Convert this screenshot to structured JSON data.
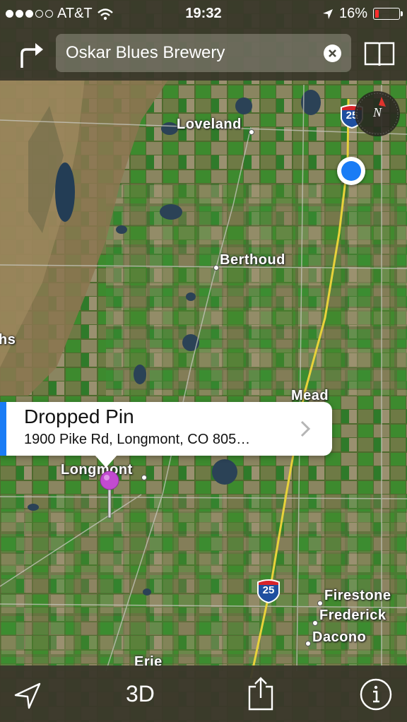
{
  "status_bar": {
    "carrier": "AT&T",
    "signal_bars": 3,
    "signal_total": 5,
    "time": "19:32",
    "battery_percent": "16%",
    "battery_level": 0.16
  },
  "search": {
    "value": "Oskar Blues Brewery"
  },
  "map": {
    "places": {
      "loveland": "Loveland",
      "berthoud": "Berthoud",
      "mead": "Mead",
      "longmont": "Longmont",
      "firestone": "Firestone",
      "frederick": "Frederick",
      "dacono": "Dacono",
      "erie": "Erie",
      "partial_left": "hs"
    },
    "highway_shield_top": "25",
    "highway_shield_bottom": "25",
    "compass_label": "N"
  },
  "callout": {
    "title": "Dropped Pin",
    "address": "1900 Pike Rd, Longmont, CO  805…"
  },
  "toolbar": {
    "three_d_label": "3D"
  },
  "colors": {
    "accent_blue": "#1a7cf5",
    "pin_purple": "#c24bd0",
    "highway_yellow": "#e8d23a"
  },
  "icons": {
    "directions": "turn-right-arrow-icon",
    "clear": "clear-x-icon",
    "bookmarks": "open-book-icon",
    "compass": "compass-icon",
    "location": "location-arrow-icon",
    "share": "share-icon",
    "info": "info-icon"
  }
}
